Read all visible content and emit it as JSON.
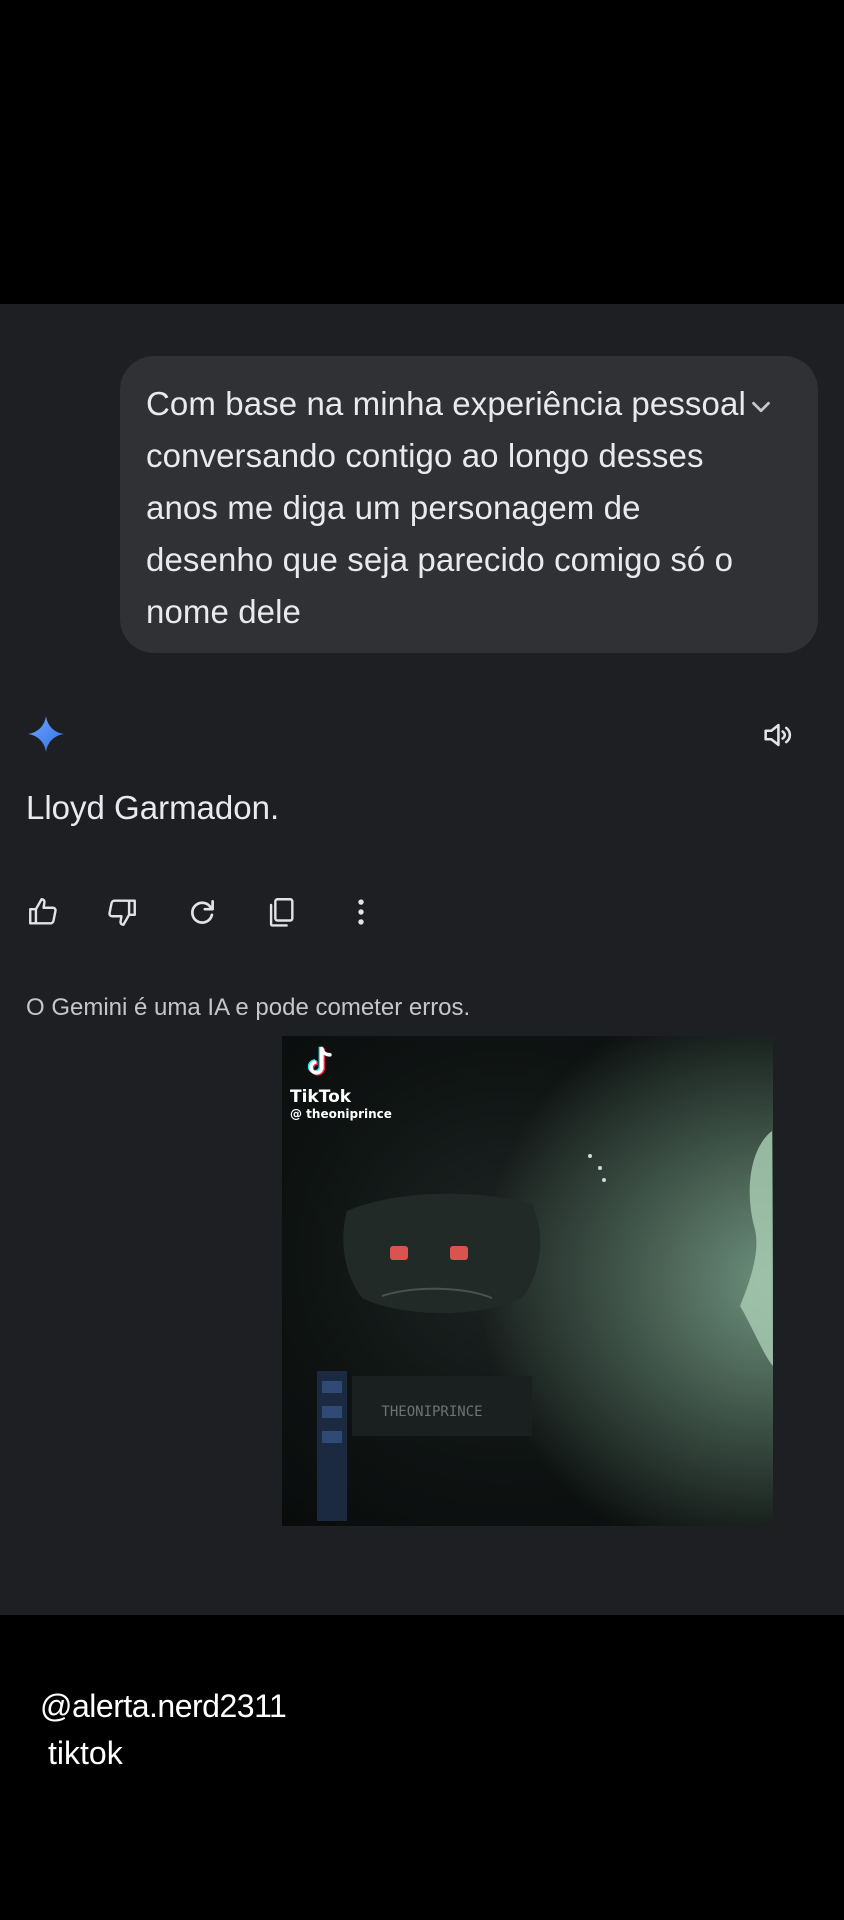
{
  "conversation": {
    "user_prompt": "Com base na minha experiência pessoal conversando contigo ao longo desses anos me diga um personagem de desenho que seja parecido comigo só o nome dele",
    "response_text": "Lloyd Garmadon.",
    "disclaimer": "O Gemini é uma IA e pode cometer erros."
  },
  "icons": {
    "expand": "chevron-down-icon",
    "assistant": "gemini-spark-icon",
    "speaker": "speaker-icon",
    "actions": [
      "thumbs-up-icon",
      "thumbs-down-icon",
      "regenerate-icon",
      "copy-icon",
      "more-vert-icon"
    ]
  },
  "video_embed": {
    "brand": "TikTok",
    "handle": "@ theoniprince",
    "overlay_text": "THEONIPRINCE"
  },
  "overlay_watermark": {
    "username": "@alerta.nerd2311",
    "platform": "tiktok"
  },
  "colors": {
    "panel_bg": "#1e1f23",
    "bubble_bg": "#303134",
    "spark_blue": "#4c8df6"
  }
}
